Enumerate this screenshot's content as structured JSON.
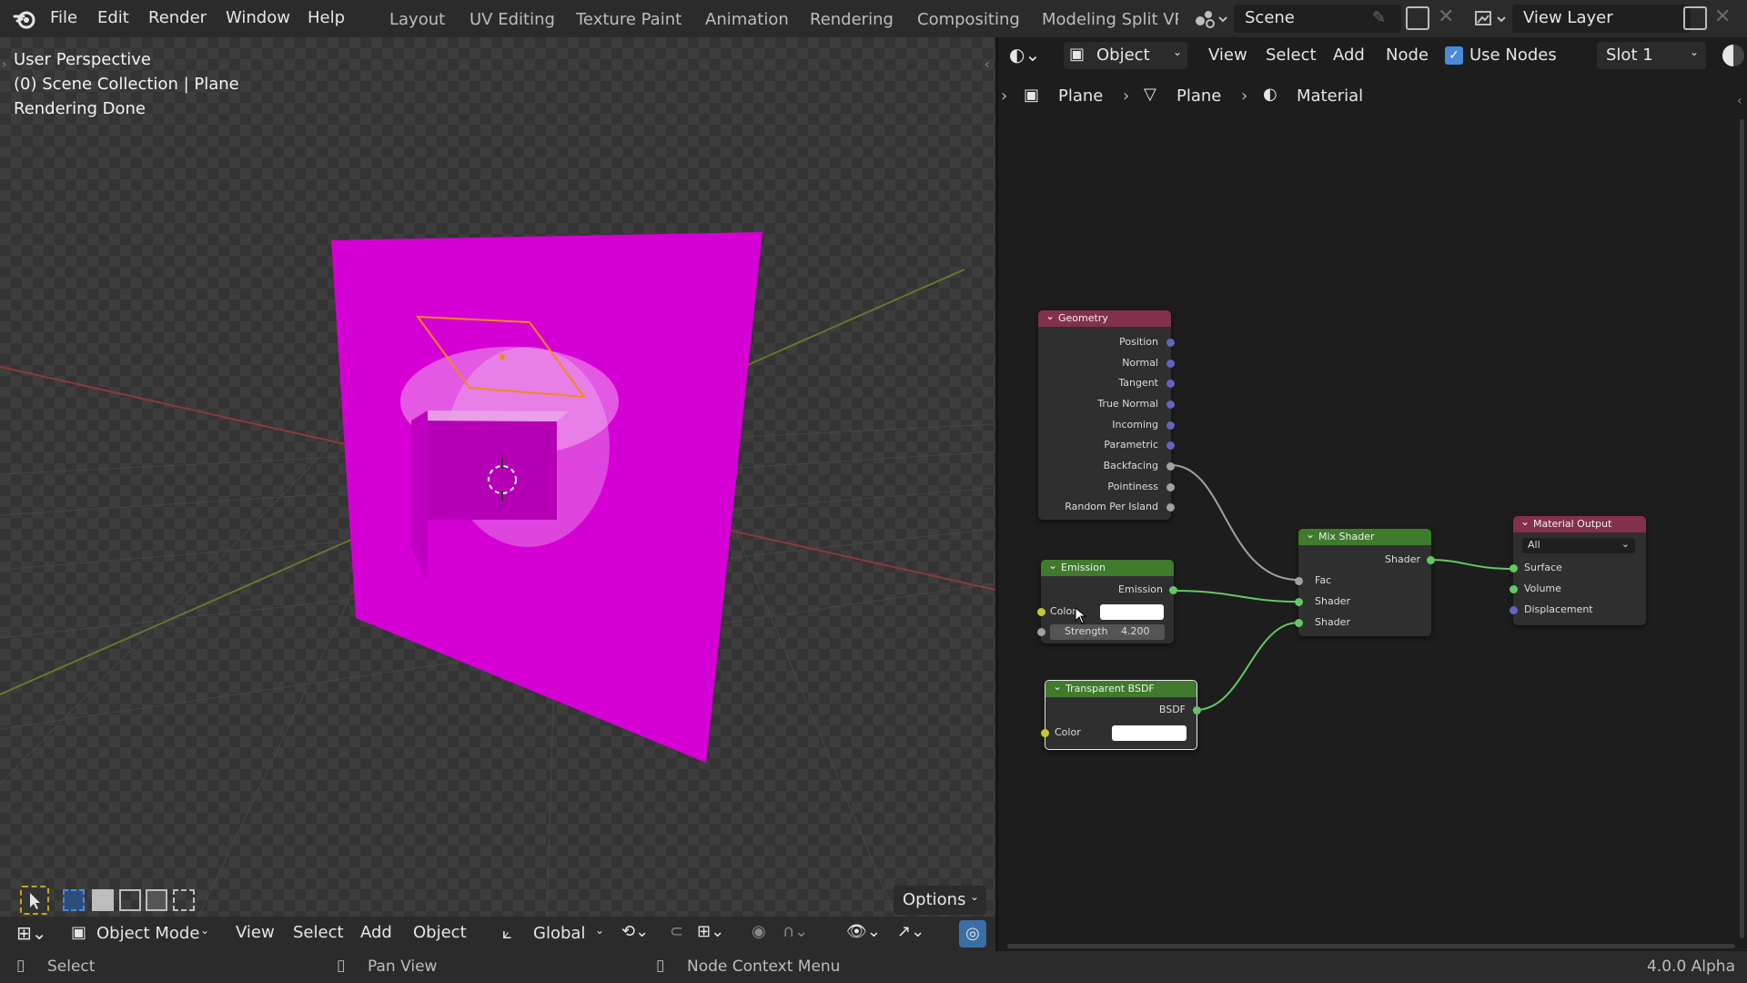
{
  "topbar": {
    "menus": [
      "File",
      "Edit",
      "Render",
      "Window",
      "Help"
    ],
    "workspaces": [
      "Layout",
      "UV Editing",
      "Texture Paint",
      "Animation",
      "Rendering",
      "Compositing",
      "Modeling Split VPs"
    ],
    "scene": "Scene",
    "view_layer": "View Layer"
  },
  "viewport": {
    "overlay": [
      "User Perspective",
      "(0) Scene Collection | Plane",
      "Rendering Done"
    ],
    "options_label": "Options",
    "header": {
      "mode": "Object Mode",
      "menus": [
        "View",
        "Select",
        "Add",
        "Object"
      ],
      "orientation": "Global"
    },
    "plane_color": "#d400d4"
  },
  "node_editor": {
    "header": {
      "object_type": "Object",
      "menus": [
        "View",
        "Select",
        "Add",
        "Node"
      ],
      "use_nodes": "Use Nodes",
      "slot": "Slot 1"
    },
    "breadcrumb": [
      "Plane",
      "Plane",
      "Material"
    ],
    "nodes": {
      "geometry": {
        "title": "Geometry",
        "outputs": [
          "Position",
          "Normal",
          "Tangent",
          "True Normal",
          "Incoming",
          "Parametric",
          "Backfacing",
          "Pointiness",
          "Random Per Island"
        ]
      },
      "emission": {
        "title": "Emission",
        "output": "Emission",
        "color_label": "Color",
        "strength_label": "Strength",
        "strength_value": "4.200"
      },
      "transparent": {
        "title": "Transparent BSDF",
        "output": "BSDF",
        "color_label": "Color"
      },
      "mix": {
        "title": "Mix Shader",
        "output": "Shader",
        "inputs": [
          "Fac",
          "Shader",
          "Shader"
        ]
      },
      "output": {
        "title": "Material Output",
        "target": "All",
        "inputs": [
          "Surface",
          "Volume",
          "Displacement"
        ]
      }
    }
  },
  "footer": {
    "select": "Select",
    "pan_view": "Pan View",
    "node_context": "Node Context Menu",
    "version": "4.0.0 Alpha"
  }
}
